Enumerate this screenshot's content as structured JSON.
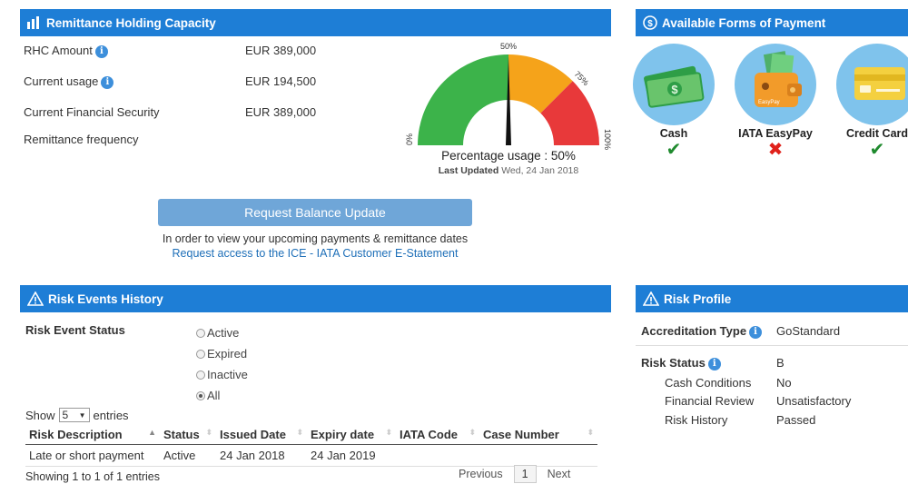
{
  "rhc": {
    "title": "Remittance Holding Capacity",
    "rows": [
      {
        "label": "RHC Amount",
        "value": "EUR 389,000"
      },
      {
        "label": "Current usage",
        "value": "EUR 194,500"
      },
      {
        "label": "Current Financial Security",
        "value": "EUR 389,000"
      },
      {
        "label": "Remittance frequency",
        "value": ""
      }
    ],
    "gauge": {
      "percent": 50,
      "tick_0": "0%",
      "tick_50": "50%",
      "tick_75": "75%",
      "tick_100": "100%",
      "usage_text": "Percentage usage : 50%",
      "last_updated_label": "Last Updated",
      "last_updated_value": "Wed, 24 Jan 2018",
      "colors": {
        "green": "#3cb34a",
        "orange": "#f5a31a",
        "red": "#e8393a",
        "needle": "#111111"
      }
    },
    "request_button": "Request Balance Update",
    "note": "In order to view your upcoming payments & remittance dates",
    "link": "Request access to the ICE - IATA Customer E-Statement"
  },
  "payment": {
    "title": "Available Forms of Payment",
    "items": [
      {
        "label": "Cash",
        "available": true,
        "mark": "✔"
      },
      {
        "label": "IATA EasyPay",
        "available": false,
        "mark": "✖"
      },
      {
        "label": "Credit Card",
        "available": true,
        "mark": "✔"
      }
    ],
    "easypay_card_text": "EasyPay",
    "colors": {
      "check": "#1f8a2e",
      "cross": "#e0211b",
      "circle": "#7fc3ec"
    }
  },
  "risk_events": {
    "title": "Risk Events History",
    "status_label": "Risk Event Status",
    "options": [
      {
        "label": "Active",
        "selected": false
      },
      {
        "label": "Expired",
        "selected": false
      },
      {
        "label": "Inactive",
        "selected": false
      },
      {
        "label": "All",
        "selected": true
      }
    ],
    "show_label": "Show",
    "show_value": "5",
    "entries_label": "entries",
    "columns": [
      "Risk Description",
      "Status",
      "Issued Date",
      "Expiry date",
      "IATA Code",
      "Case Number"
    ],
    "rows": [
      {
        "risk_description": "Late or short payment",
        "status": "Active",
        "issued_date": "24 Jan 2018",
        "expiry_date": "24 Jan 2019",
        "iata_code": "",
        "case_number": ""
      }
    ],
    "info": "Showing 1 to 1 of 1 entries",
    "pager": {
      "previous": "Previous",
      "page": "1",
      "next": "Next"
    }
  },
  "risk_profile": {
    "title": "Risk Profile",
    "accreditation_label": "Accreditation Type",
    "accreditation_value": "GoStandard",
    "risk_status_label": "Risk Status",
    "risk_status_value": "B",
    "details": [
      {
        "label": "Cash Conditions",
        "value": "No"
      },
      {
        "label": "Financial Review",
        "value": "Unsatisfactory"
      },
      {
        "label": "Risk History",
        "value": "Passed"
      }
    ]
  },
  "theme": {
    "header_blue": "#1e7ed6",
    "button_blue": "#6fa6d8",
    "link_blue": "#1e6fb8"
  }
}
